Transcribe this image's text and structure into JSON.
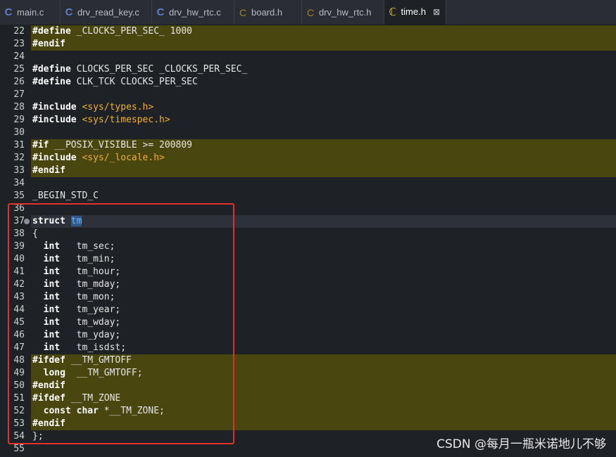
{
  "tabs": [
    {
      "label": "main.c",
      "icon": "c-file-icon",
      "type": "c"
    },
    {
      "label": "drv_read_key.c",
      "icon": "c-file-icon",
      "type": "c"
    },
    {
      "label": "drv_hw_rtc.c",
      "icon": "c-file-icon",
      "type": "c"
    },
    {
      "label": "board.h",
      "icon": "h-file-icon",
      "type": "h"
    },
    {
      "label": "drv_hw_rtc.h",
      "icon": "h-file-icon",
      "type": "h"
    },
    {
      "label": "time.h",
      "icon": "active-header-icon",
      "type": "th",
      "active": true,
      "close_glyph": "⊠"
    }
  ],
  "tab_icon_glyphs": {
    "c": "C",
    "h": "C",
    "th": "ℂ"
  },
  "colors": {
    "highlight": "#4a4610",
    "keyword": "#ffffff",
    "string": "#f0b030",
    "selection": "#2e5a8c",
    "annotation_box": "#e0302a"
  },
  "lines": [
    {
      "n": "22",
      "hl": true,
      "tokens": [
        {
          "t": "#define",
          "c": "kw"
        },
        {
          "t": " _CLOCKS_PER_SEC_ 1000",
          "c": "plain"
        }
      ]
    },
    {
      "n": "23",
      "hl": true,
      "tokens": [
        {
          "t": "#endif",
          "c": "kw"
        }
      ]
    },
    {
      "n": "24",
      "tokens": []
    },
    {
      "n": "25",
      "tokens": [
        {
          "t": "#define",
          "c": "kw"
        },
        {
          "t": " CLOCKS_PER_SEC _CLOCKS_PER_SEC_",
          "c": "plain"
        }
      ]
    },
    {
      "n": "26",
      "tokens": [
        {
          "t": "#define",
          "c": "kw"
        },
        {
          "t": " CLK_TCK CLOCKS_PER_SEC",
          "c": "plain"
        }
      ]
    },
    {
      "n": "27",
      "tokens": []
    },
    {
      "n": "28",
      "tokens": [
        {
          "t": "#include",
          "c": "kw"
        },
        {
          "t": " ",
          "c": "plain"
        },
        {
          "t": "<sys/types.h>",
          "c": "str"
        }
      ]
    },
    {
      "n": "29",
      "tokens": [
        {
          "t": "#include",
          "c": "kw"
        },
        {
          "t": " ",
          "c": "plain"
        },
        {
          "t": "<sys/timespec.h>",
          "c": "str"
        }
      ]
    },
    {
      "n": "30",
      "tokens": []
    },
    {
      "n": "31",
      "hl": true,
      "tokens": [
        {
          "t": "#if",
          "c": "kw"
        },
        {
          "t": " __POSIX_VISIBLE >= 200809",
          "c": "plain"
        }
      ]
    },
    {
      "n": "32",
      "hl": true,
      "tokens": [
        {
          "t": "#include",
          "c": "kw"
        },
        {
          "t": " ",
          "c": "plain"
        },
        {
          "t": "<sys/_locale.h>",
          "c": "str"
        }
      ]
    },
    {
      "n": "33",
      "hl": true,
      "tokens": [
        {
          "t": "#endif",
          "c": "kw"
        }
      ]
    },
    {
      "n": "34",
      "tokens": []
    },
    {
      "n": "35",
      "tokens": [
        {
          "t": "_BEGIN_STD_C",
          "c": "plain"
        }
      ]
    },
    {
      "n": "36",
      "tokens": []
    },
    {
      "n": "37",
      "cur": true,
      "marker": true,
      "tokens": [
        {
          "t": "struct",
          "c": "kw"
        },
        {
          "t": " ",
          "c": "plain"
        },
        {
          "t": "tm",
          "c": "sel"
        }
      ]
    },
    {
      "n": "38",
      "tokens": [
        {
          "t": "{",
          "c": "plain"
        }
      ]
    },
    {
      "n": "39",
      "tokens": [
        {
          "t": "  ",
          "c": "plain"
        },
        {
          "t": "int",
          "c": "kw"
        },
        {
          "t": "   tm_sec;",
          "c": "plain"
        }
      ]
    },
    {
      "n": "40",
      "tokens": [
        {
          "t": "  ",
          "c": "plain"
        },
        {
          "t": "int",
          "c": "kw"
        },
        {
          "t": "   tm_min;",
          "c": "plain"
        }
      ]
    },
    {
      "n": "41",
      "tokens": [
        {
          "t": "  ",
          "c": "plain"
        },
        {
          "t": "int",
          "c": "kw"
        },
        {
          "t": "   tm_hour;",
          "c": "plain"
        }
      ]
    },
    {
      "n": "42",
      "tokens": [
        {
          "t": "  ",
          "c": "plain"
        },
        {
          "t": "int",
          "c": "kw"
        },
        {
          "t": "   tm_mday;",
          "c": "plain"
        }
      ]
    },
    {
      "n": "43",
      "tokens": [
        {
          "t": "  ",
          "c": "plain"
        },
        {
          "t": "int",
          "c": "kw"
        },
        {
          "t": "   tm_mon;",
          "c": "plain"
        }
      ]
    },
    {
      "n": "44",
      "tokens": [
        {
          "t": "  ",
          "c": "plain"
        },
        {
          "t": "int",
          "c": "kw"
        },
        {
          "t": "   tm_year;",
          "c": "plain"
        }
      ]
    },
    {
      "n": "45",
      "tokens": [
        {
          "t": "  ",
          "c": "plain"
        },
        {
          "t": "int",
          "c": "kw"
        },
        {
          "t": "   tm_wday;",
          "c": "plain"
        }
      ]
    },
    {
      "n": "46",
      "tokens": [
        {
          "t": "  ",
          "c": "plain"
        },
        {
          "t": "int",
          "c": "kw"
        },
        {
          "t": "   tm_yday;",
          "c": "plain"
        }
      ]
    },
    {
      "n": "47",
      "tokens": [
        {
          "t": "  ",
          "c": "plain"
        },
        {
          "t": "int",
          "c": "kw"
        },
        {
          "t": "   tm_isdst;",
          "c": "plain"
        }
      ]
    },
    {
      "n": "48",
      "hl": true,
      "tokens": [
        {
          "t": "#ifdef",
          "c": "kw"
        },
        {
          "t": " __TM_GMTOFF",
          "c": "plain"
        }
      ]
    },
    {
      "n": "49",
      "hl": true,
      "tokens": [
        {
          "t": "  ",
          "c": "plain"
        },
        {
          "t": "long",
          "c": "kw"
        },
        {
          "t": "  __TM_GMTOFF;",
          "c": "plain"
        }
      ]
    },
    {
      "n": "50",
      "hl": true,
      "tokens": [
        {
          "t": "#endif",
          "c": "kw"
        }
      ]
    },
    {
      "n": "51",
      "hl": true,
      "tokens": [
        {
          "t": "#ifdef",
          "c": "kw"
        },
        {
          "t": " __TM_ZONE",
          "c": "plain"
        }
      ]
    },
    {
      "n": "52",
      "hl": true,
      "tokens": [
        {
          "t": "  ",
          "c": "plain"
        },
        {
          "t": "const",
          "c": "kw"
        },
        {
          "t": " ",
          "c": "plain"
        },
        {
          "t": "char",
          "c": "kw"
        },
        {
          "t": " *__TM_ZONE;",
          "c": "plain"
        }
      ]
    },
    {
      "n": "53",
      "hl": true,
      "tokens": [
        {
          "t": "#endif",
          "c": "kw"
        }
      ]
    },
    {
      "n": "54",
      "tokens": [
        {
          "t": "};",
          "c": "plain"
        }
      ]
    },
    {
      "n": "55",
      "tokens": []
    }
  ],
  "watermark": "CSDN @每月一瓶米诺地儿不够"
}
